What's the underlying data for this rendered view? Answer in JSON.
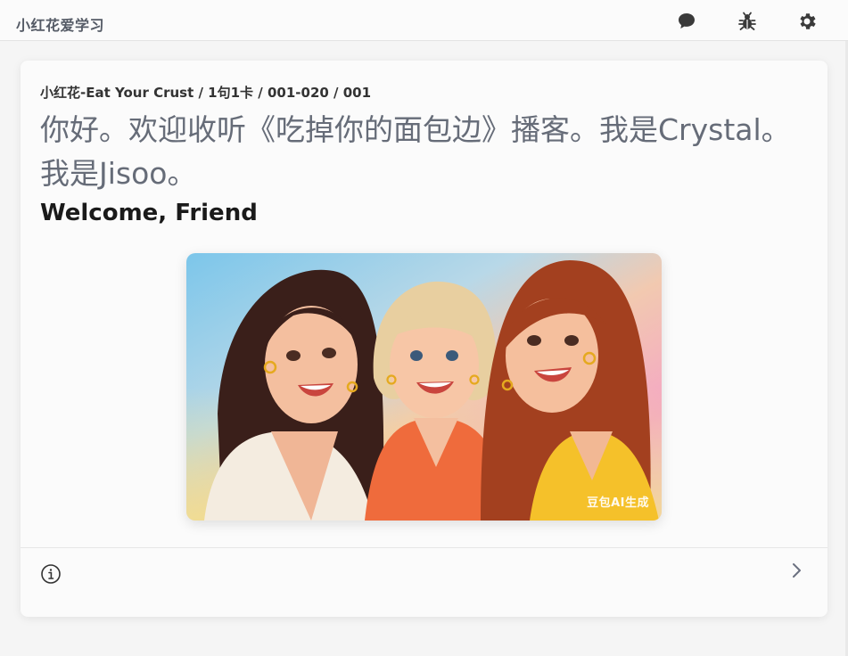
{
  "app": {
    "title": "小红花爱学习"
  },
  "toolbar": {
    "icons": [
      "chat-bubble-icon",
      "bug-icon",
      "gear-icon"
    ]
  },
  "card": {
    "breadcrumb": "小红花-Eat Your Crust / 1句1卡 / 001-020 / 001",
    "sentence": "你好。欢迎收听《吃掉你的面包边》播客。我是Crystal。我是Jisoo。",
    "translation": "Welcome, Friend",
    "image": {
      "description": "illustration of three smiling women taking a selfie",
      "watermark": "豆包AI生成"
    },
    "footer": {
      "icons": [
        "info-icon",
        "chevron-right-icon"
      ]
    }
  },
  "colors": {
    "title_text": "#555b66",
    "sentence_text": "#666c78",
    "icon": "#3a3a3a"
  }
}
